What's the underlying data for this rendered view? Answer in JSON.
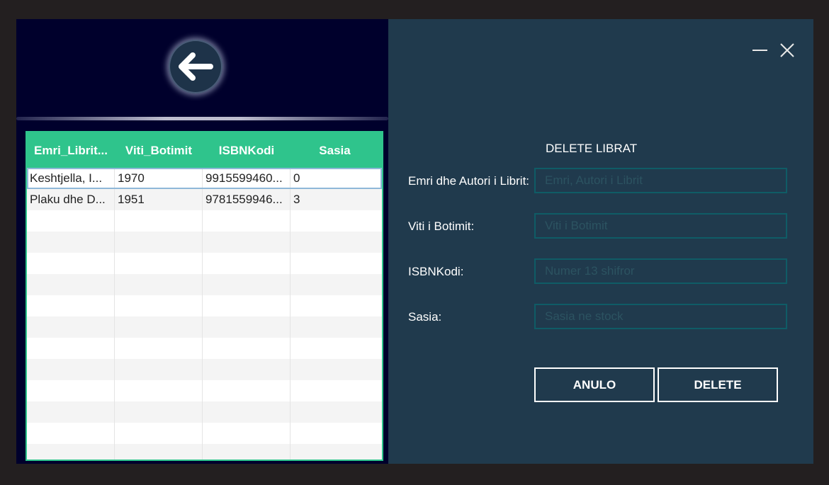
{
  "table": {
    "columns": [
      "Emri_Librit...",
      "Viti_Botimit",
      "ISBNKodi",
      "Sasia"
    ],
    "rows": [
      [
        "Keshtjella, I...",
        "1970",
        "9915599460...",
        "0"
      ],
      [
        "Plaku dhe D...",
        "1951",
        "9781559946...",
        "3"
      ]
    ],
    "empty_rows": 12
  },
  "form": {
    "title": "DELETE LIBRAT",
    "fields": [
      {
        "label": "Emri dhe Autori i Librit:",
        "placeholder": "Emri, Autori i Librit",
        "value": ""
      },
      {
        "label": "Viti i Botimit:",
        "placeholder": "Viti i Botimit",
        "value": ""
      },
      {
        "label": "ISBNKodi:",
        "placeholder": "Numer 13 shifror",
        "value": ""
      },
      {
        "label": "Sasia:",
        "placeholder": "Sasia ne stock",
        "value": ""
      }
    ],
    "cancel_label": "ANULO",
    "delete_label": "DELETE"
  },
  "icons": {
    "back": "back-arrow-icon",
    "minimize": "minimize-icon",
    "close": "close-icon"
  },
  "colors": {
    "table_header": "#2fc48c",
    "left_panel": "#00002c",
    "right_panel": "#203a4d",
    "input_border": "#0f5c66"
  }
}
